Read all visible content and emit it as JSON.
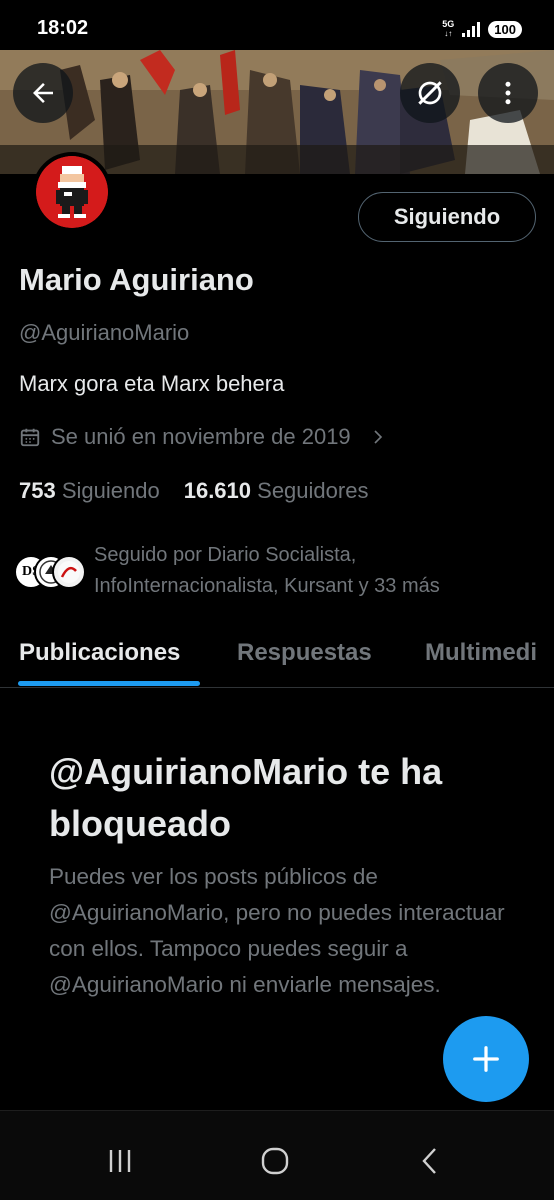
{
  "status_bar": {
    "time": "18:02",
    "network": "5G",
    "battery": "100"
  },
  "profile": {
    "display_name": "Mario Aguiriano",
    "handle": "@AguirianoMario",
    "bio": "Marx gora eta Marx behera",
    "joined": "Se unió en noviembre de 2019",
    "following_count": "753",
    "following_label": "Siguiendo",
    "followers_count": "16.610",
    "followers_label": "Seguidores",
    "follow_button": "Siguiendo",
    "followed_by_text": "Seguido por Diario Socialista, InfoInternacionalista, Kursant y 33 más",
    "followed_by_avatar_1": "DS"
  },
  "tabs": [
    {
      "label": "Publicaciones",
      "active": true
    },
    {
      "label": "Respuestas",
      "active": false
    },
    {
      "label": "Multimedi",
      "active": false
    }
  ],
  "block_notice": {
    "title": "@AguirianoMario te ha bloqueado",
    "body": "Puedes ver los posts públicos de @AguirianoMario, pero no puedes interactuar con ellos. Tampoco puedes seguir a @AguirianoMario ni enviarle mensajes."
  },
  "colors": {
    "accent": "#1d9bf0",
    "muted": "#71767b",
    "text": "#e7e9ea",
    "background": "#000000"
  },
  "icons": [
    "arrow-left-icon",
    "grok-icon",
    "more-vertical-icon",
    "calendar-icon",
    "chevron-right-icon",
    "plus-icon",
    "recent-apps-icon",
    "home-icon",
    "nav-back-icon"
  ]
}
